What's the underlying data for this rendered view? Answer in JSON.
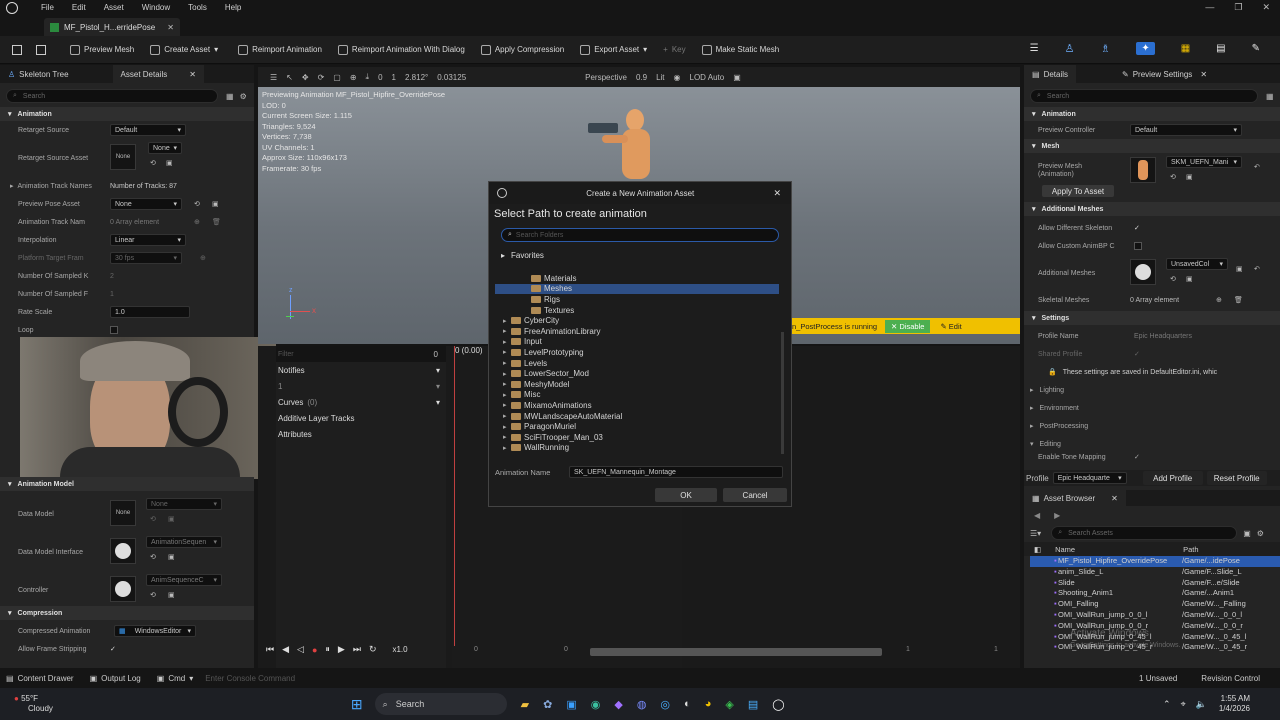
{
  "title_bar": {
    "menu": [
      "File",
      "Edit",
      "Asset",
      "Window",
      "Tools",
      "Help"
    ]
  },
  "document_tab": {
    "label": "MF_Pistol_H...erridePose"
  },
  "toolbar": {
    "buttons": [
      "Preview Mesh",
      "Create Asset",
      "Reimport Animation",
      "Reimport Animation With Dialog",
      "Apply Compression",
      "Export Asset",
      "Key",
      "Make Static Mesh"
    ]
  },
  "left_panel": {
    "tabs": [
      "Skeleton Tree",
      "Asset Details"
    ],
    "search_placeholder": "Search",
    "animation_section": "Animation",
    "props": [
      {
        "label": "Retarget Source",
        "value": "Default"
      },
      {
        "label": "Retarget Source Asset",
        "value": "None"
      },
      {
        "label": "Animation Track Names",
        "value": "Number of Tracks: 87"
      },
      {
        "label": "Preview Pose Asset",
        "value": "None"
      },
      {
        "label": "Animation Track Nam",
        "value": "0 Array element"
      },
      {
        "label": "Interpolation",
        "value": "Linear"
      },
      {
        "label": "Platform Target Fram",
        "value": "30 fps"
      },
      {
        "label": "Number Of Sampled K",
        "value": "2"
      },
      {
        "label": "Number Of Sampled F",
        "value": "1"
      },
      {
        "label": "Rate Scale",
        "value": "1.0"
      },
      {
        "label": "Loop",
        "value": ""
      }
    ],
    "retarget_none_combo": "None",
    "anim_model_section": "Animation Model",
    "model_props": [
      {
        "label": "Data Model",
        "thumb": "None",
        "value": "None"
      },
      {
        "label": "Data Model Interface",
        "thumb": "",
        "value": "AnimationSequen"
      },
      {
        "label": "Controller",
        "thumb": "",
        "value": "AnimSequenceC"
      }
    ],
    "compression_section": "Compression",
    "compression_props": [
      {
        "label": "Compressed Animation",
        "value": "WindowsEditor"
      },
      {
        "label": "Allow Frame Stripping",
        "value": ""
      }
    ]
  },
  "viewport": {
    "toolbar": {
      "camera": "Perspective",
      "lit": "Lit",
      "lod": "LOD Auto",
      "fov": "2.812°",
      "step": "0.03125",
      "zero": "0",
      "one": "1",
      "pt9": "0.9"
    },
    "overlay_lines": [
      "Previewing Animation MF_Pistol_Hipfire_OverridePose",
      "LOD: 0",
      "Current Screen Size: 1.115",
      "Triangles: 9,524",
      "Vertices: 7,738",
      "UV Channels: 1",
      "Approx Size: 110x96x173",
      "Framerate: 30 fps"
    ],
    "notice": "n_PostProcess is running",
    "disable_label": "✕ Disable",
    "edit_label": "✎ Edit"
  },
  "timeline": {
    "filter_placeholder": "Filter",
    "count": "0",
    "time": "0 (0.00)",
    "tracks": [
      "Notifies",
      "1",
      "Curves",
      "(0)",
      "Additive Layer Tracks",
      "Attributes"
    ],
    "speed": "x1.0",
    "ruler": [
      "0",
      "0",
      "1",
      "1"
    ]
  },
  "dialog": {
    "title": "Create a New Animation Asset",
    "heading": "Select Path to create animation",
    "search_placeholder": "Search Folders",
    "favorites": "Favorites",
    "folders": [
      {
        "name": "Materials",
        "indent": 2,
        "selected": false
      },
      {
        "name": "Meshes",
        "indent": 2,
        "selected": true
      },
      {
        "name": "Rigs",
        "indent": 2,
        "selected": false
      },
      {
        "name": "Textures",
        "indent": 2,
        "selected": false
      },
      {
        "name": "CyberCity",
        "indent": 1,
        "selected": false
      },
      {
        "name": "FreeAnimationLibrary",
        "indent": 1,
        "selected": false
      },
      {
        "name": "Input",
        "indent": 1,
        "selected": false
      },
      {
        "name": "LevelPrototyping",
        "indent": 1,
        "selected": false
      },
      {
        "name": "Levels",
        "indent": 1,
        "selected": false
      },
      {
        "name": "LowerSector_Mod",
        "indent": 1,
        "selected": false
      },
      {
        "name": "MeshyModel",
        "indent": 1,
        "selected": false
      },
      {
        "name": "Misc",
        "indent": 1,
        "selected": false
      },
      {
        "name": "MixamoAnimations",
        "indent": 1,
        "selected": false
      },
      {
        "name": "MWLandscapeAutoMaterial",
        "indent": 1,
        "selected": false
      },
      {
        "name": "ParagonMuriel",
        "indent": 1,
        "selected": false
      },
      {
        "name": "SciFiTrooper_Man_03",
        "indent": 1,
        "selected": false
      },
      {
        "name": "WallRunning",
        "indent": 1,
        "selected": false
      }
    ],
    "name_label": "Animation Name",
    "name_value": "SK_UEFN_Mannequin_Montage",
    "ok": "OK",
    "cancel": "Cancel"
  },
  "right_panel": {
    "tabs": [
      "Details",
      "Preview Settings"
    ],
    "search_placeholder": "Search",
    "animation_section": "Animation",
    "preview_controller": {
      "label": "Preview Controller",
      "value": "Default"
    },
    "mesh_section": "Mesh",
    "preview_mesh": {
      "label": "Preview Mesh (Animation)",
      "value": "SKM_UEFN_Mani"
    },
    "apply_to_asset": "Apply To Asset",
    "additional_meshes_section": "Additional Meshes",
    "allow_diff_skel": "Allow Different Skeleton",
    "allow_custom_bp": "Allow Custom AnimBP C",
    "additional_meshes": {
      "label": "Additional Meshes",
      "value": "UnsavedCol"
    },
    "skeletal_meshes": {
      "label": "Skeletal Meshes",
      "value": "0 Array element"
    },
    "settings_section": "Settings",
    "profile_name": {
      "label": "Profile Name",
      "value": "Epic Headquarters"
    },
    "shared_profile": "Shared Profile",
    "saved_note": "These settings are saved in DefaultEditor.ini, whic",
    "subsections": [
      "Lighting",
      "Environment",
      "PostProcessing",
      "Editing"
    ],
    "enable_tone": "Enable Tone Mapping",
    "profile_combo": "Epic Headquarte",
    "profile_label": "Profile",
    "add_profile": "Add Profile",
    "reset_profile": "Reset Profile"
  },
  "asset_browser": {
    "tab": "Asset Browser",
    "search_placeholder": "Search Assets",
    "columns": [
      "Name",
      "Path"
    ],
    "rows": [
      {
        "name": "MF_Pistol_Hipfire_OverridePose",
        "path": "/Game/...idePose",
        "selected": true
      },
      {
        "name": "anim_Slide_L",
        "path": "/Game/F...Slide_L",
        "selected": false
      },
      {
        "name": "Slide",
        "path": "/Game/F...e/Slide",
        "selected": false
      },
      {
        "name": "Shooting_Anim1",
        "path": "/Game/...Anim1",
        "selected": false
      },
      {
        "name": "OMI_Falling",
        "path": "/Game/W..._Falling",
        "selected": false
      },
      {
        "name": "OMI_WallRun_jump_0_0_l",
        "path": "/Game/W..._0_0_l",
        "selected": false
      },
      {
        "name": "OMI_WallRun_jump_0_0_r",
        "path": "/Game/W..._0_0_r",
        "selected": false
      },
      {
        "name": "OMI_WallRun_jump_0_45_l",
        "path": "/Game/W..._0_45_l",
        "selected": false
      },
      {
        "name": "OMI_WallRun_jump_0_45_r",
        "path": "/Game/W..._0_45_r",
        "selected": false
      }
    ]
  },
  "status_bar": {
    "content_drawer": "Content Drawer",
    "output_log": "Output Log",
    "cmd": "Cmd",
    "console_placeholder": "Enter Console Command",
    "unsaved": "1 Unsaved",
    "revision": "Revision Control"
  },
  "taskbar": {
    "weather_temp": "55°F",
    "weather_desc": "Cloudy",
    "search_placeholder": "Search",
    "time": "1:55 AM",
    "date": "1/4/2026"
  },
  "watermark": [
    "Activate Windows",
    "Go to Settings to activate Windows."
  ],
  "colors": {
    "accent_blue": "#2b5aa8",
    "folder_selected": "#2e4f86",
    "notice_yellow": "#f0c000",
    "asset_selected": "#2a5bb0"
  }
}
